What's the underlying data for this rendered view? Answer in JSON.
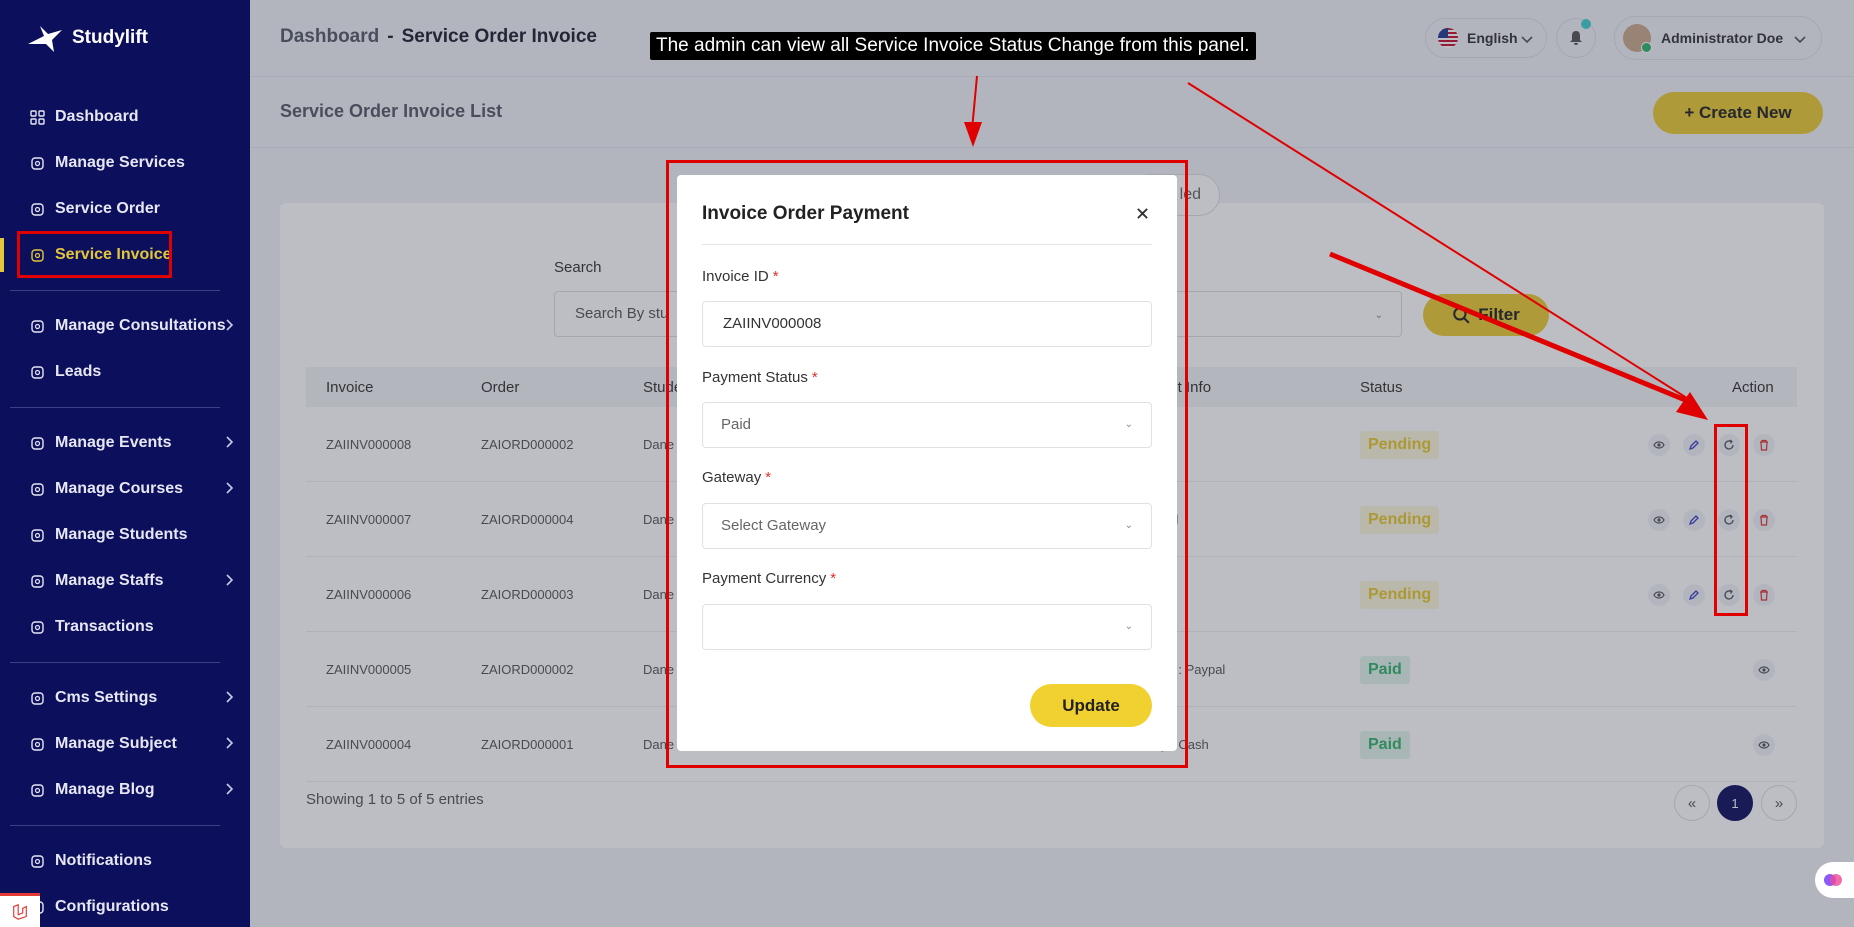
{
  "brand": {
    "name": "Studylift"
  },
  "sidebar": {
    "items": [
      {
        "label": "Dashboard",
        "icon": "dashboard-icon",
        "chevron": false,
        "active": false
      },
      {
        "label": "Manage Services",
        "icon": "services-icon",
        "chevron": false,
        "active": false
      },
      {
        "label": "Service Order",
        "icon": "order-icon",
        "chevron": false,
        "active": false
      },
      {
        "label": "Service Invoice",
        "icon": "invoice-icon",
        "chevron": false,
        "active": true
      },
      {
        "label": "Manage Consultations",
        "icon": "consultation-icon",
        "chevron": true,
        "active": false
      },
      {
        "label": "Leads",
        "icon": "leads-icon",
        "chevron": false,
        "active": false
      },
      {
        "label": "Manage Events",
        "icon": "calendar-icon",
        "chevron": true,
        "active": false
      },
      {
        "label": "Manage Courses",
        "icon": "courses-icon",
        "chevron": true,
        "active": false
      },
      {
        "label": "Manage Students",
        "icon": "students-icon",
        "chevron": false,
        "active": false
      },
      {
        "label": "Manage Staffs",
        "icon": "staff-icon",
        "chevron": true,
        "active": false
      },
      {
        "label": "Transactions",
        "icon": "transactions-icon",
        "chevron": false,
        "active": false
      },
      {
        "label": "Cms Settings",
        "icon": "gear-icon",
        "chevron": true,
        "active": false
      },
      {
        "label": "Manage Subject",
        "icon": "book-icon",
        "chevron": true,
        "active": false
      },
      {
        "label": "Manage Blog",
        "icon": "blog-icon",
        "chevron": true,
        "active": false
      },
      {
        "label": "Notifications",
        "icon": "bell-icon",
        "chevron": false,
        "active": false
      },
      {
        "label": "Configurations",
        "icon": "settings-icon",
        "chevron": false,
        "active": false
      }
    ]
  },
  "header": {
    "breadcrumb_root": "Dashboard",
    "breadcrumb_sep": "-",
    "breadcrumb_current": "Service Order Invoice",
    "language": "English",
    "user_name": "Administrator Doe"
  },
  "annotation": {
    "tooltip": "The admin can view all Service Invoice Status Change from this panel."
  },
  "list": {
    "title": "Service Order Invoice List",
    "create_label": "+ Create New",
    "tab_partial": "led",
    "search_label": "Search",
    "search_placeholder": "Search By stu",
    "filter_label": "Filter",
    "columns": [
      "Invoice",
      "Order",
      "Stude",
      "ent Info",
      "Status",
      "Action"
    ],
    "rows": [
      {
        "invoice": "ZAIINV000008",
        "order": "ZAIORD000002",
        "student": "Dane",
        "info": "",
        "status": "Pending",
        "actions": true
      },
      {
        "invoice": "ZAIINV000007",
        "order": "ZAIORD000004",
        "student": "Dane",
        "info": "aid",
        "status": "Pending",
        "actions": true
      },
      {
        "invoice": "ZAIINV000006",
        "order": "ZAIORD000003",
        "student": "Dane",
        "info": "",
        "status": "Pending",
        "actions": true
      },
      {
        "invoice": "ZAIINV000005",
        "order": "ZAIORD000002",
        "student": "Dane",
        "info": "ay : Paypal",
        "status": "Paid",
        "actions": false
      },
      {
        "invoice": "ZAIINV000004",
        "order": "ZAIORD000001",
        "student": "Dane",
        "info": "y : Cash",
        "status": "Paid",
        "actions": false
      }
    ],
    "showing": "Showing 1 to 5 of 5 entries",
    "pagination": {
      "prev": "«",
      "current": "1",
      "next": "»"
    }
  },
  "modal": {
    "title": "Invoice Order Payment",
    "invoice_id_label": "Invoice ID",
    "invoice_id_value": "ZAIINV000008",
    "payment_status_label": "Payment Status",
    "payment_status_value": "Paid",
    "gateway_label": "Gateway",
    "gateway_placeholder": "Select Gateway",
    "currency_label": "Payment Currency",
    "currency_value": "",
    "required_mark": "*",
    "update_label": "Update"
  },
  "colors": {
    "sidebar_bg": "#0c0f5c",
    "accent": "#e9cb31",
    "annotation_red": "#e00000"
  }
}
